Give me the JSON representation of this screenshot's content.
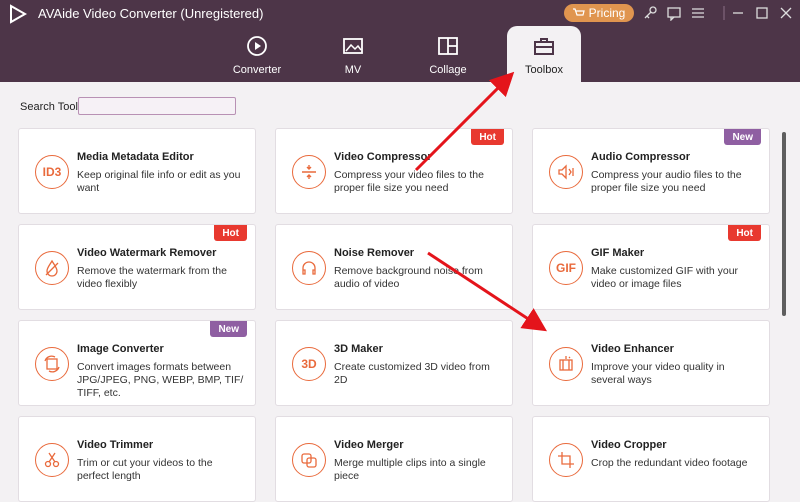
{
  "window": {
    "title": "AVAide Video Converter (Unregistered)",
    "pricing_label": "Pricing"
  },
  "tabs": [
    {
      "label": "Converter"
    },
    {
      "label": "MV"
    },
    {
      "label": "Collage"
    },
    {
      "label": "Toolbox"
    }
  ],
  "search": {
    "label": "Search Tool:",
    "value": ""
  },
  "tools": [
    {
      "title": "Media Metadata Editor",
      "desc": "Keep original file info or edit as you want",
      "icon": "ID3",
      "badge": ""
    },
    {
      "title": "Video Compressor",
      "desc": "Compress your video files to the proper file size you need",
      "icon": "compress-icon",
      "badge": "Hot"
    },
    {
      "title": "Audio Compressor",
      "desc": "Compress your audio files to the proper file size you need",
      "icon": "audio-compress-icon",
      "badge": "New"
    },
    {
      "title": "Video Watermark Remover",
      "desc": "Remove the watermark from the video flexibly",
      "icon": "watermark-icon",
      "badge": "Hot"
    },
    {
      "title": "Noise Remover",
      "desc": "Remove background noise from audio of video",
      "icon": "headphones-icon",
      "badge": ""
    },
    {
      "title": "GIF Maker",
      "desc": "Make customized GIF with your video or image files",
      "icon": "GIF",
      "badge": "Hot"
    },
    {
      "title": "Image Converter",
      "desc": "Convert images formats between JPG/JPEG, PNG, WEBP, BMP, TIF/ TIFF, etc.",
      "icon": "image-convert-icon",
      "badge": "New"
    },
    {
      "title": "3D Maker",
      "desc": "Create customized 3D video from 2D",
      "icon": "3D",
      "badge": ""
    },
    {
      "title": "Video Enhancer",
      "desc": "Improve your video quality in several ways",
      "icon": "enhance-icon",
      "badge": ""
    },
    {
      "title": "Video Trimmer",
      "desc": "Trim or cut your videos to the perfect length",
      "icon": "scissors-icon",
      "badge": ""
    },
    {
      "title": "Video Merger",
      "desc": "Merge multiple clips into a single piece",
      "icon": "merge-icon",
      "badge": ""
    },
    {
      "title": "Video Cropper",
      "desc": "Crop the redundant video footage",
      "icon": "crop-icon",
      "badge": ""
    }
  ],
  "colors": {
    "titlebar": "#4d3548",
    "accent": "#e96a3c",
    "hot": "#e8392f",
    "new": "#8f5fa2",
    "pricing": "#e0954f",
    "arrow": "#e4141b"
  }
}
